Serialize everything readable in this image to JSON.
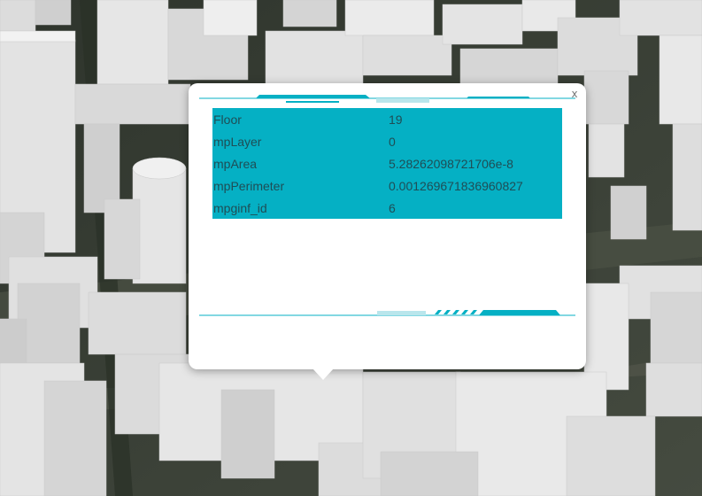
{
  "popup": {
    "close_label": "x",
    "rows": [
      {
        "key": "Floor",
        "value": "19"
      },
      {
        "key": "mpLayer",
        "value": "0"
      },
      {
        "key": "mpArea",
        "value": "5.28262098721706e-8"
      },
      {
        "key": "mpPerimeter",
        "value": "0.001269671836960827"
      },
      {
        "key": "mpginf_id",
        "value": "6"
      }
    ]
  },
  "colors": {
    "accent": "#05b0c4",
    "table_text": "#1f4d55"
  }
}
